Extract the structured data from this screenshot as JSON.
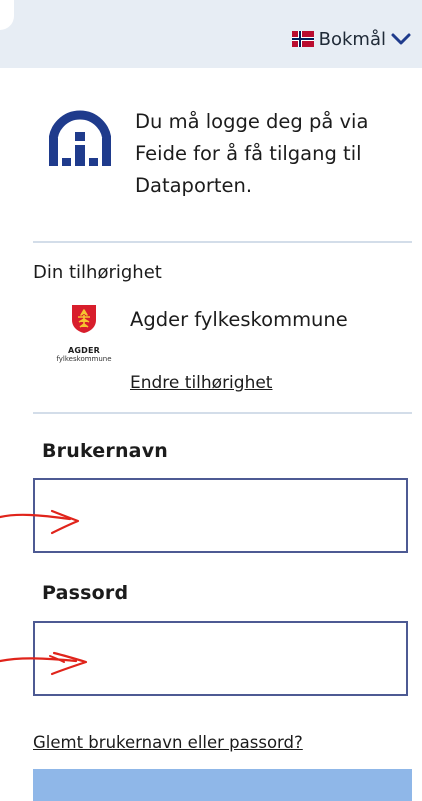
{
  "topbar": {
    "language": {
      "label": "Bokmål",
      "flag_icon": "norway-flag-icon",
      "chevron_icon": "chevron-down-icon"
    }
  },
  "intro": {
    "logo_icon": "feide-logo",
    "text": "Du må logge deg på via Feide for å få tilgang til Dataporten."
  },
  "affiliation": {
    "label": "Din tilhørighet",
    "logo_icon": "agder-crest-icon",
    "logo_name": "AGDER",
    "logo_subtitle": "fylkeskommune",
    "organization": "Agder fylkeskommune",
    "change_link": "Endre tilhørighet"
  },
  "form": {
    "username_label": "Brukernavn",
    "username_value": "",
    "password_label": "Passord",
    "password_value": "",
    "forgot_link": "Glemt brukernavn eller passord?"
  },
  "colors": {
    "topbar_bg": "#e7edf4",
    "accent": "#1f3b8c",
    "input_border": "#4d5a93",
    "button_bg": "#8fb7e8",
    "annotation": "#e0241b"
  }
}
